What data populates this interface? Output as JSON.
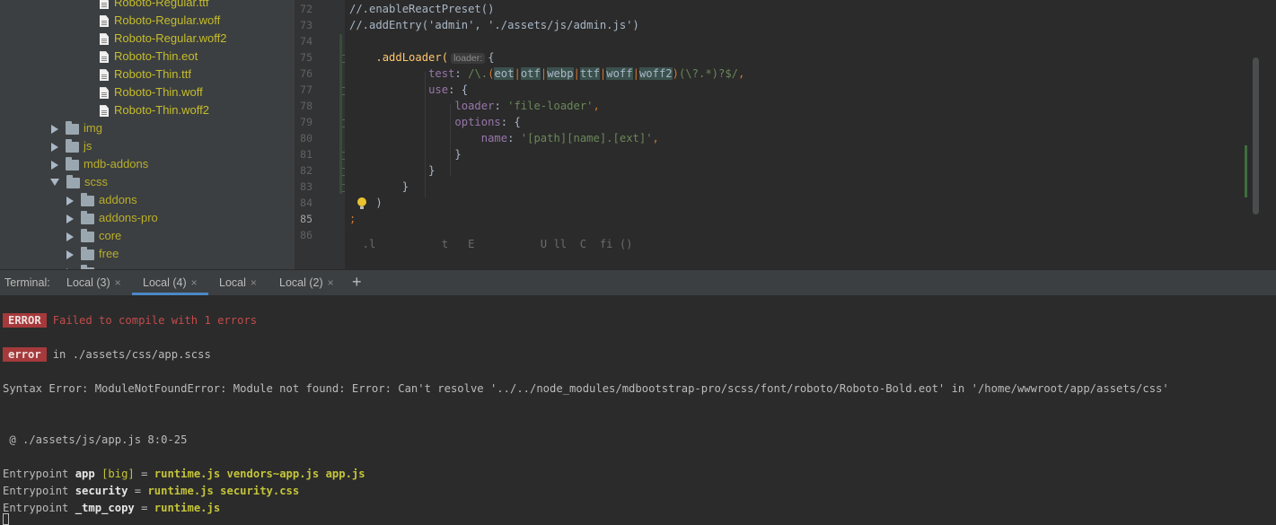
{
  "tree": {
    "files": [
      "Roboto-Regular.ttf",
      "Roboto-Regular.woff",
      "Roboto-Regular.woff2",
      "Roboto-Thin.eot",
      "Roboto-Thin.ttf",
      "Roboto-Thin.woff",
      "Roboto-Thin.woff2"
    ],
    "folders_level1": [
      "img",
      "js",
      "mdb-addons"
    ],
    "scss_label": "scss",
    "scss_children": [
      "addons",
      "addons-pro",
      "core",
      "free"
    ]
  },
  "editor": {
    "line_numbers": [
      "72",
      "73",
      "74",
      "75",
      "76",
      "77",
      "78",
      "79",
      "80",
      "81",
      "82",
      "83",
      "84",
      "85",
      "86"
    ],
    "current_line": "85",
    "l72": "//.enableReactPreset()",
    "l73": "//.addEntry('admin', './assets/js/admin.js')",
    "addloader_fn": ".addLoader(",
    "param_hint": "loader:",
    "open_brace": "{",
    "test_key": "test",
    "use_key": "use",
    "loader_key": "loader",
    "loader_val": "'file-loader'",
    "options_key": "options",
    "name_key": "name",
    "name_val": "'[path][name].[ext]'",
    "regex_parts": [
      "eot",
      "otf",
      "webp",
      "ttf",
      "woff",
      "woff2"
    ],
    "regex_prefix": "/\\.",
    "regex_query": "(\\?.*)?$/",
    "semicolon": ";",
    "close_paren": ")",
    "close_brace": "}",
    "l86_fragment": "  .l          t   E          U ll  C  fi ()"
  },
  "terminal": {
    "label": "Terminal:",
    "tabs": [
      {
        "label": "Local (3)",
        "active": false
      },
      {
        "label": "Local (4)",
        "active": true
      },
      {
        "label": "Local",
        "active": false
      },
      {
        "label": "Local (2)",
        "active": false
      }
    ],
    "close_glyph": "×",
    "add_glyph": "+",
    "error_badge": "ERROR",
    "error_msg": "Failed to compile with 1 errors",
    "error_badge2": "error",
    "error_location": "in ./assets/css/app.scss",
    "syntax_error": "Syntax Error: ModuleNotFoundError: Module not found: Error: Can't resolve '../../node_modules/mdbootstrap-pro/scss/font/roboto/Roboto-Bold.eot' in '/home/wwwroot/app/assets/css'",
    "at_line": " @ ./assets/js/app.js 8:0-25",
    "ep_label": "Entrypoint",
    "ep1_name": "app",
    "ep1_tag": "[big]",
    "ep1_files": "runtime.js vendors~app.js app.js",
    "ep2_name": "security",
    "ep2_files": "runtime.js security.css",
    "ep3_name": "_tmp_copy",
    "ep3_files": "runtime.js",
    "equals": "="
  },
  "colors": {
    "accent": "#4a88c7",
    "error_badge": "#a5393b",
    "tree_text": "#c5bd2b"
  }
}
